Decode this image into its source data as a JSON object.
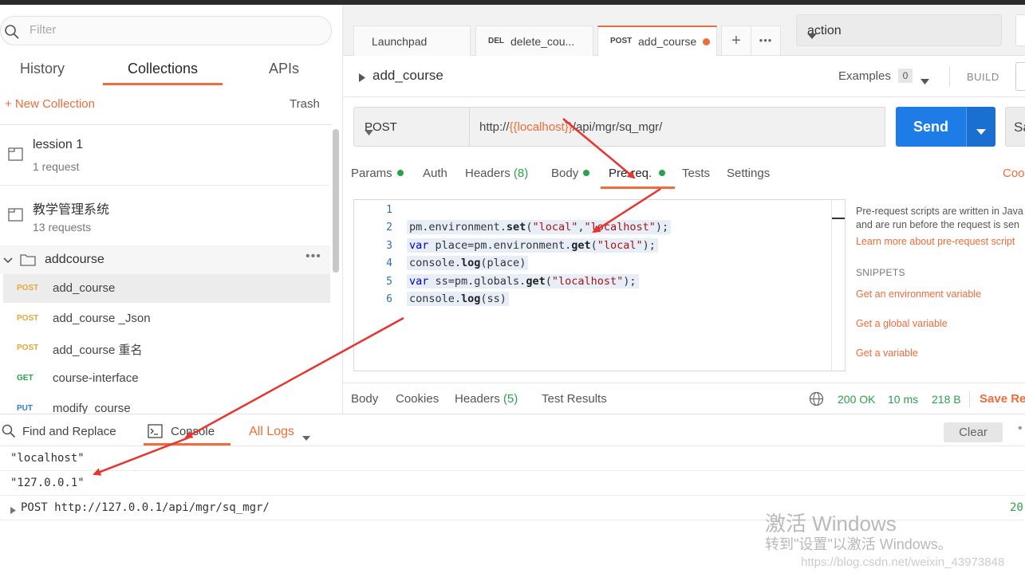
{
  "sidebar": {
    "filter_placeholder": "Filter",
    "tabs": [
      "History",
      "Collections",
      "APIs"
    ],
    "new_collection": "+ New Collection",
    "trash": "Trash",
    "collections": [
      {
        "name": "lession 1",
        "sub": "1 request"
      },
      {
        "name": "教学管理系统",
        "sub": "13 requests"
      }
    ],
    "folder": {
      "name": "addcourse",
      "more": "•••"
    },
    "requests": [
      {
        "method": "POST",
        "name": "add_course"
      },
      {
        "method": "POST",
        "name": "add_course _Json"
      },
      {
        "method": "POST",
        "name": "add_course 重名"
      },
      {
        "method": "GET",
        "name": "course-interface"
      },
      {
        "method": "PUT",
        "name": "modify_course"
      }
    ]
  },
  "tabs": {
    "items": [
      {
        "method": "",
        "label": "Launchpad"
      },
      {
        "method": "DEL",
        "label": "delete_cou..."
      },
      {
        "method": "POST",
        "label": "add_course"
      }
    ],
    "plus": "+",
    "more": "•••"
  },
  "environment": {
    "selected": "action"
  },
  "request": {
    "name": "add_course",
    "examples_label": "Examples",
    "examples_count": "0",
    "build_label": "BUILD",
    "method": "POST",
    "url_prefix": "http://",
    "url_var": "{{localhost}}",
    "url_suffix": "/api/mgr/sq_mgr/",
    "send": "Send",
    "save": "Sa"
  },
  "request_tabs": {
    "params": "Params",
    "auth": "Auth",
    "headers": "Headers",
    "headers_count": "(8)",
    "body": "Body",
    "prereq": "Pre-req.",
    "tests": "Tests",
    "settings": "Settings",
    "cookies": "Coo"
  },
  "editor": {
    "line_numbers": [
      "1",
      "2",
      "3",
      "4",
      "5",
      "6"
    ],
    "lines": {
      "l2": [
        "pm.environment.",
        "set",
        "(",
        "\"local\"",
        ",",
        "\"localhost\"",
        ");"
      ],
      "l3": [
        "var",
        " place=pm.environment.",
        "get",
        "(",
        "\"local\"",
        ");"
      ],
      "l4": [
        "console.",
        "log",
        "(place)"
      ],
      "l5": [
        "var",
        " ss=pm.globals.",
        "get",
        "(",
        "\"localhost\"",
        ");"
      ],
      "l6": [
        "console.",
        "log",
        "(ss)"
      ]
    }
  },
  "help": {
    "line1": "Pre-request scripts are written in Java",
    "line2": "and are run before the request is sen",
    "learn": "Learn more about pre-request script",
    "snippets": "SNIPPETS",
    "s1": "Get an environment variable",
    "s2": "Get a global variable",
    "s3": "Get a variable"
  },
  "response": {
    "body": "Body",
    "cookies": "Cookies",
    "headers": "Headers",
    "headers_count": "(5)",
    "test_results": "Test Results",
    "status": "200 OK",
    "time": "10 ms",
    "size": "218 B",
    "save": "Save Res"
  },
  "console": {
    "find_replace": "Find and Replace",
    "console": "Console",
    "all_logs": "All Logs",
    "clear": "Clear",
    "dots": "•",
    "logs": [
      "\"localhost\"",
      "\"127.0.0.1\""
    ],
    "request_log": "POST http://127.0.0.1/api/mgr/sq_mgr/",
    "request_status": "20"
  },
  "watermark": {
    "line1": "激活 Windows",
    "line2": "转到\"设置\"以激活 Windows。",
    "csdn": "https://blog.csdn.net/weixin_43973848"
  },
  "colors": {
    "accent": "#f26b3a",
    "send": "#1e7ce6",
    "success": "#2aa14b",
    "arrow": "#e8342e"
  }
}
